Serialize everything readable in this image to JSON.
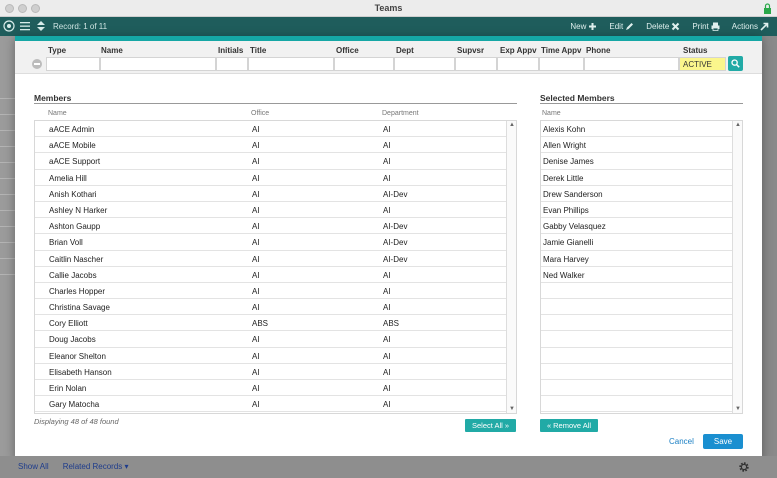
{
  "window": {
    "title": "Teams"
  },
  "toolbar": {
    "record_label": "Record: 1 of 11",
    "actions": [
      {
        "label": "New",
        "icon": "plus-icon"
      },
      {
        "label": "Edit",
        "icon": "pencil-icon"
      },
      {
        "label": "Delete",
        "icon": "x-icon"
      },
      {
        "label": "Print",
        "icon": "printer-icon"
      },
      {
        "label": "Actions",
        "icon": "arrow-icon"
      }
    ]
  },
  "filter": {
    "labels": {
      "type": "Type",
      "name": "Name",
      "initials": "Initials",
      "title": "Title",
      "office": "Office",
      "dept": "Dept",
      "supvsr": "Supvsr",
      "exp_appv": "Exp Appv",
      "time_appv": "Time Appv",
      "phone": "Phone",
      "status": "Status"
    },
    "status_value": "ACTIVE"
  },
  "members": {
    "title": "Members",
    "columns": {
      "name": "Name",
      "office": "Office",
      "department": "Department"
    },
    "rows": [
      {
        "name": "aACE Admin",
        "office": "AI",
        "department": "AI"
      },
      {
        "name": "aACE Mobile",
        "office": "AI",
        "department": "AI"
      },
      {
        "name": "aACE Support",
        "office": "AI",
        "department": "AI"
      },
      {
        "name": "Amelia Hill",
        "office": "AI",
        "department": "AI"
      },
      {
        "name": "Anish Kothari",
        "office": "AI",
        "department": "AI-Dev"
      },
      {
        "name": "Ashley N Harker",
        "office": "AI",
        "department": "AI"
      },
      {
        "name": "Ashton Gaupp",
        "office": "AI",
        "department": "AI-Dev"
      },
      {
        "name": "Brian Voll",
        "office": "AI",
        "department": "AI-Dev"
      },
      {
        "name": "Caitlin Nascher",
        "office": "AI",
        "department": "AI-Dev"
      },
      {
        "name": "Callie Jacobs",
        "office": "AI",
        "department": "AI"
      },
      {
        "name": "Charles Hopper",
        "office": "AI",
        "department": "AI"
      },
      {
        "name": "Christina Savage",
        "office": "AI",
        "department": "AI"
      },
      {
        "name": "Cory Elliott",
        "office": "ABS",
        "department": "ABS"
      },
      {
        "name": "Doug Jacobs",
        "office": "AI",
        "department": "AI"
      },
      {
        "name": "Eleanor Shelton",
        "office": "AI",
        "department": "AI"
      },
      {
        "name": "Elisabeth Hanson",
        "office": "AI",
        "department": "AI"
      },
      {
        "name": "Erin Nolan",
        "office": "AI",
        "department": "AI"
      },
      {
        "name": "Gary Matocha",
        "office": "AI",
        "department": "AI"
      }
    ],
    "displaying": "Displaying 48 of 48 found",
    "select_all_label": "Select All"
  },
  "selected": {
    "title": "Selected Members",
    "columns": {
      "name": "Name"
    },
    "rows": [
      "Alexis Kohn",
      "Allen Wright",
      "Denise James",
      "Derek Little",
      "Drew Sanderson",
      "Evan Phillips",
      "Gabby Velasquez",
      "Jamie Gianelli",
      "Mara Harvey",
      "Ned Walker"
    ],
    "remove_all_label": "Remove All"
  },
  "buttons": {
    "cancel": "Cancel",
    "save": "Save"
  },
  "footer": {
    "show_all": "Show All",
    "related_records": "Related Records"
  }
}
